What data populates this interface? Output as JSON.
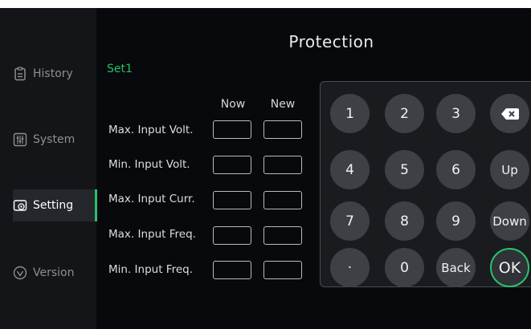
{
  "sidebar": {
    "items": [
      {
        "label": "History",
        "icon": "clipboard-icon",
        "active": false
      },
      {
        "label": "System",
        "icon": "sliders-icon",
        "active": false
      },
      {
        "label": "Setting",
        "icon": "settings-icon",
        "active": true
      },
      {
        "label": "Version",
        "icon": "check-circle-icon",
        "active": false
      }
    ]
  },
  "header": {
    "title": "Protection",
    "set_name": "Set1"
  },
  "table": {
    "columns": [
      "Now",
      "New"
    ],
    "rows": [
      {
        "label": "Max. Input Volt.",
        "now": "",
        "new": ""
      },
      {
        "label": "Min. Input Volt.",
        "now": "",
        "new": ""
      },
      {
        "label": "Max. Input Curr.",
        "now": "",
        "new": ""
      },
      {
        "label": "Max. Input Freq.",
        "now": "",
        "new": ""
      },
      {
        "label": "Min. Input Freq.",
        "now": "",
        "new": ""
      }
    ]
  },
  "keypad": {
    "keys": [
      "1",
      "2",
      "3",
      "backspace",
      "4",
      "5",
      "6",
      "Up",
      "7",
      "8",
      "9",
      "Down",
      "·",
      "0",
      "Back",
      "OK"
    ],
    "labels": {
      "k1": "1",
      "k2": "2",
      "k3": "3",
      "k4": "4",
      "k5": "5",
      "k6": "6",
      "up": "Up",
      "k7": "7",
      "k8": "8",
      "k9": "9",
      "down": "Down",
      "dot": "·",
      "k0": "0",
      "back": "Back",
      "ok": "OK"
    }
  },
  "colors": {
    "accent": "#27c06a",
    "background": "#07090c",
    "sidebar": "#131518",
    "key": "#3d4045"
  }
}
